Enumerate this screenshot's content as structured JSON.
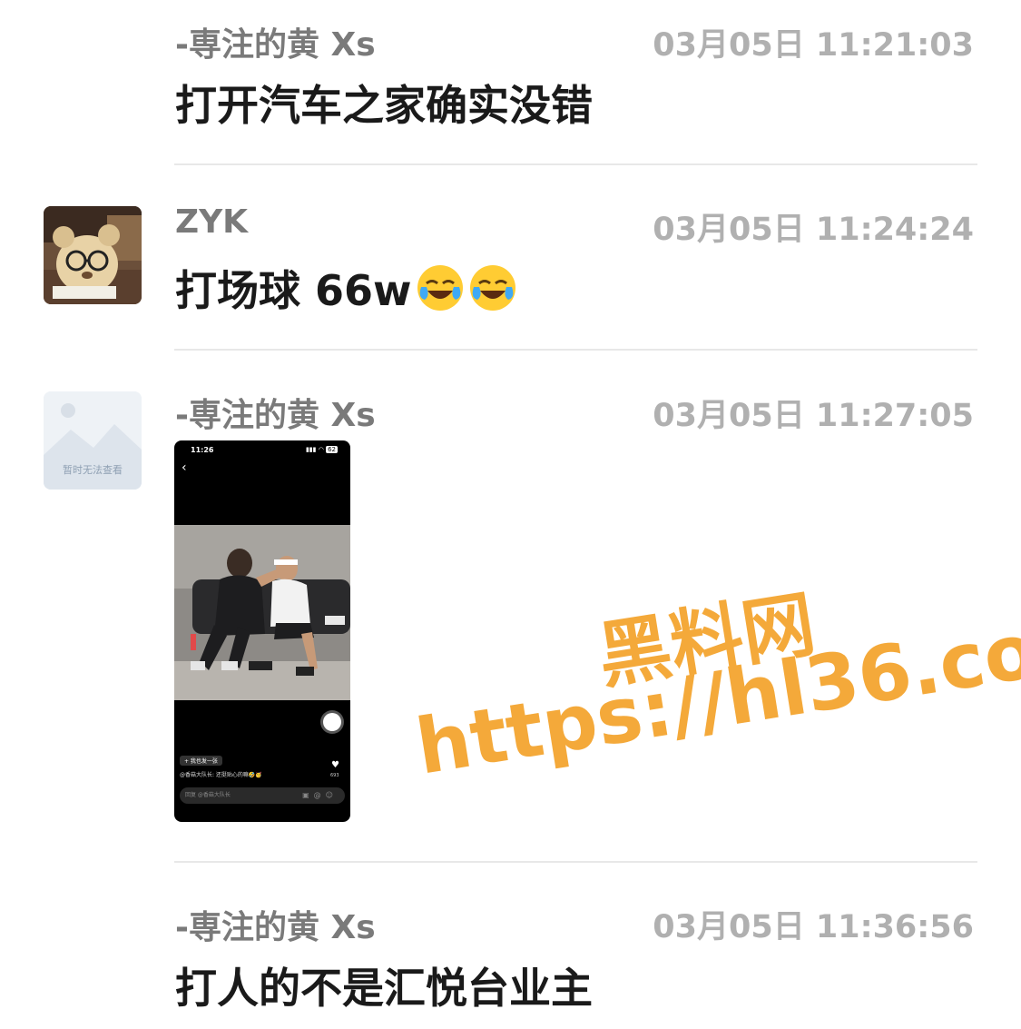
{
  "messages": [
    {
      "sender": "-専注的黄 Xs",
      "time": "03月05日 11:21:03",
      "text": "打开汽车之家确实没错"
    },
    {
      "sender": "ZYK",
      "time": "03月05日 11:24:24",
      "text": "打场球 66w",
      "emojis": [
        "face-with-tears-of-joy-icon",
        "face-with-tears-of-joy-icon"
      ]
    },
    {
      "sender": "-専注的黄 Xs",
      "time": "03月05日 11:27:05",
      "avatar_placeholder": "暂时无法查看",
      "screenshot": {
        "status_time": "11:26",
        "battery": "62",
        "chip": "+ 我也发一张",
        "caption": "@香菇大队长: 还挺贴心的嘛🤣🥳",
        "likes": "693",
        "reply_placeholder": "回复 @香菇大队长"
      }
    },
    {
      "sender": "-専注的黄 Xs",
      "time": "03月05日 11:36:56",
      "text": "打人的不是汇悦台业主"
    }
  ],
  "watermark": {
    "title": "黑料网",
    "url": "https://hl36.co"
  },
  "colors": {
    "sender": "#7a7a7a",
    "time": "#b0b0b0",
    "message": "#1a1a1a",
    "divider": "#e8e8e8",
    "watermark": "#f4a93a"
  }
}
